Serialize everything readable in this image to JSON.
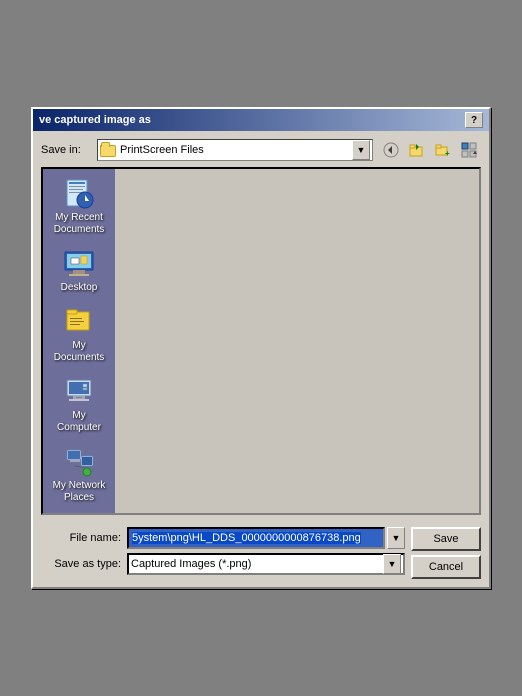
{
  "dialog": {
    "title": "ve captured image as",
    "help_btn": "?",
    "save_in_label": "Save in:",
    "save_in_value": "PrintScreen Files",
    "file_name_label": "File name:",
    "file_name_value": "5ystem\\png\\HL_DDS_0000000000876738.png",
    "save_as_type_label": "Save as type:",
    "save_as_type_value": "Captured Images (*.png)",
    "save_button": "Save",
    "cancel_button": "Cancel"
  },
  "sidebar": {
    "items": [
      {
        "id": "recent",
        "label": "My Recent\nDocuments",
        "icon": "recent"
      },
      {
        "id": "desktop",
        "label": "Desktop",
        "icon": "desktop"
      },
      {
        "id": "documents",
        "label": "My Documents",
        "icon": "documents"
      },
      {
        "id": "computer",
        "label": "My Computer",
        "icon": "computer"
      },
      {
        "id": "network",
        "label": "My Network Places",
        "icon": "network"
      }
    ]
  },
  "toolbar": {
    "back_btn": "←",
    "up_btn": "↑",
    "new_folder_btn": "📁",
    "views_btn": "⊞"
  },
  "colors": {
    "title_bar_start": "#0a246a",
    "title_bar_end": "#a6b8d8",
    "sidebar_bg": "#6e6e9a",
    "file_area_bg": "#c8c4bc",
    "filename_highlight": "#3163c5"
  }
}
